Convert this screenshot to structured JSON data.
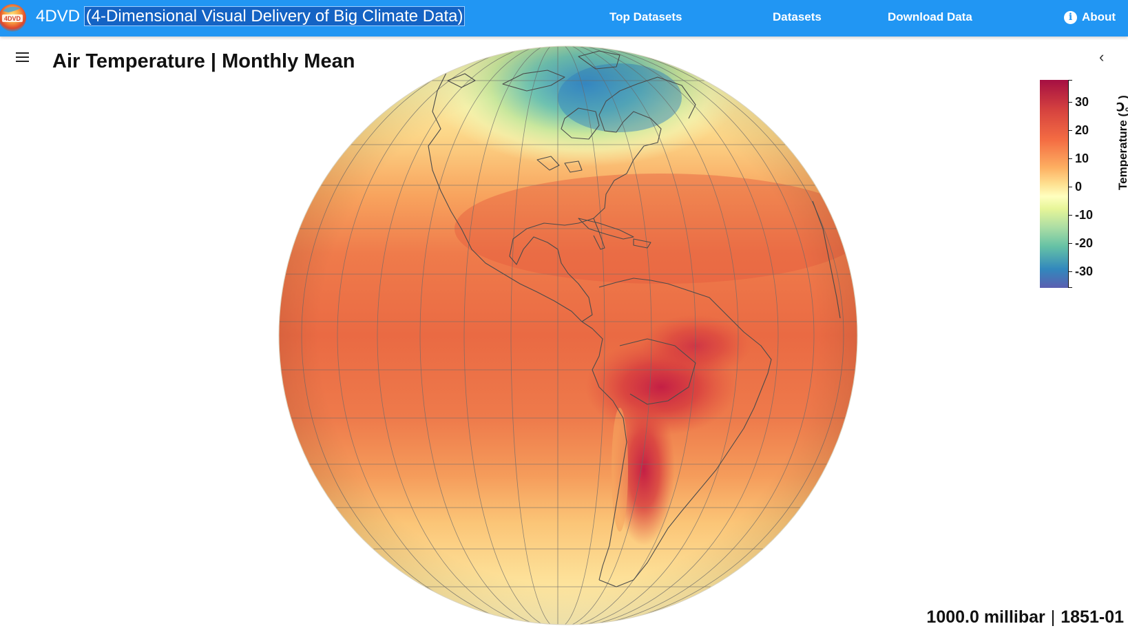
{
  "header": {
    "logo_text": "4DVD",
    "app_name": "4DVD",
    "app_subtitle": "(4-Dimensional Visual Delivery of Big Climate Data)",
    "nav": [
      {
        "label": "Top Datasets"
      },
      {
        "label": "Datasets"
      },
      {
        "label": "Download Data"
      },
      {
        "label": "About"
      }
    ]
  },
  "main": {
    "title": "Air Temperature | Monthly Mean"
  },
  "legend": {
    "title": "Temperature (℃)",
    "ticks": [
      "30",
      "20",
      "10",
      "0",
      "-10",
      "-20",
      "-30"
    ],
    "range": [
      -37,
      38
    ],
    "colors": [
      "#a50f42",
      "#f46d43",
      "#fee090",
      "#ffffbf",
      "#abdda4",
      "#3288bd",
      "#5b5fb0"
    ]
  },
  "status": {
    "level": "1000.0 millibar",
    "separator": "|",
    "date": "1851-01"
  },
  "colors": {
    "accent": "#2196f3",
    "title_highlight": "#1463c4"
  }
}
